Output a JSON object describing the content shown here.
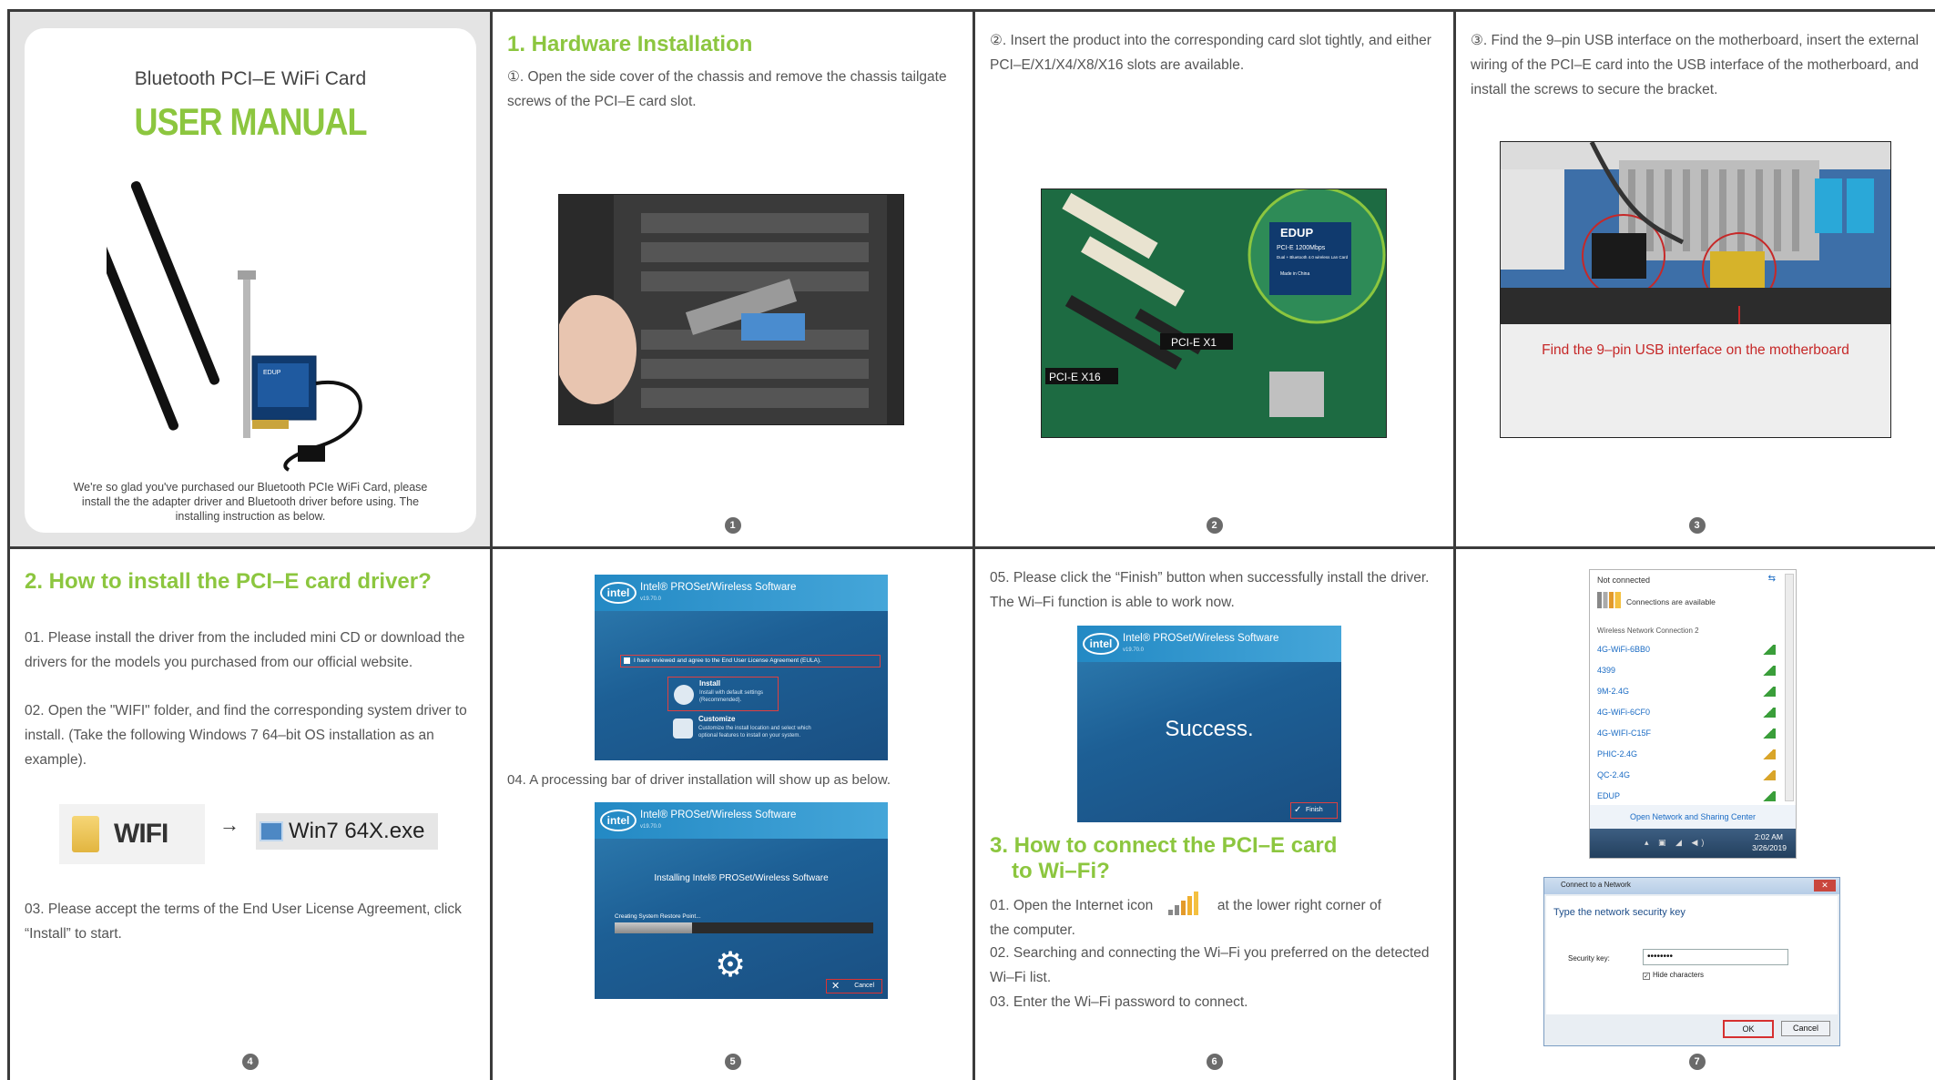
{
  "cover": {
    "subtitle": "Bluetooth PCI–E WiFi Card",
    "title": "USER MANUAL",
    "intro": "We're so glad you've purchased our Bluetooth PCIe WiFi Card, please install the the adapter driver and Bluetooth driver before using. The installing instruction as below."
  },
  "panel2": {
    "heading": "1. Hardware Installation",
    "text": "①. Open the side cover of the chassis and remove the chassis tailgate screws of the PCI–E card slot.",
    "num": "1"
  },
  "panel3": {
    "text": "②. Insert the product into the corresponding card slot tightly, and either PCI–E/X1/X4/X8/X16 slots are available.",
    "label_x1": "PCI-E X1",
    "label_x16": "PCI-E X16",
    "badge_brand": "EDUP",
    "badge_line1": "PCI-E 1200Mbps",
    "badge_line2": "Dual + Bluetooth 4.0 wireless Lan Card",
    "badge_line3": "Made in China",
    "num": "2"
  },
  "panel4": {
    "text": "③. Find the 9–pin USB interface on the motherboard, insert the external wiring of the PCI–E card into the USB interface of the motherboard, and install the screws to secure the bracket.",
    "caption": "Find the 9–pin USB interface on the motherboard",
    "num": "3"
  },
  "panel5": {
    "heading": "2. How to install the PCI–E card driver?",
    "step1": "01. Please install the driver from the included mini CD or download the drivers for the models you purchased from our official website.",
    "step2": "02. Open the \"WIFI\" folder, and find the corresponding system driver to install. (Take the following Windows 7 64–bit OS installation as an example).",
    "folder_label": "WIFI",
    "arrow": "→",
    "exe_label": "Win7 64X.exe",
    "step3": "03. Please accept the terms of the End User License Agreement, click “Install” to start.",
    "num": "4"
  },
  "panel6": {
    "intel_logo": "intel",
    "app_name": "Intel® PROSet/Wireless Software",
    "version": "v19.70.0",
    "eula": "I have reviewed and agree to the End User License Agreement (EULA).",
    "install_title": "Install",
    "install_desc": "Install with default settings (Recommended).",
    "customize_title": "Customize",
    "customize_desc": "Customize the install location and select which optional features to install on your system.",
    "step4": "04. A processing bar of driver installation will show up as below.",
    "installing": "Installing Intel® PROSet/Wireless Software",
    "restore": "Creating System Restore Point...",
    "cancel": "Cancel",
    "progress": 0.3,
    "num": "5"
  },
  "panel7": {
    "step5": "05. Please click the “Finish” button when successfully install the driver. The Wi–Fi function is able to work now.",
    "success": "Success.",
    "finish": "Finish",
    "heading_line1": "3. How to connect the PCI–E card",
    "heading_line2": "to Wi–Fi?",
    "s1a": "01. Open the Internet icon",
    "s1b": "at the lower right corner of",
    "s1c": "the computer.",
    "s2": "02.  Searching and connecting the Wi–Fi you preferred on the detected Wi–Fi list.",
    "s3": "03. Enter the Wi–Fi password to connect.",
    "num": "6"
  },
  "panel8": {
    "not_connected": "Not connected",
    "available": "Connections are available",
    "section": "Wireless Network Connection 2",
    "networks": [
      "4G-WiFi-6BB0",
      "4399",
      "9M-2.4G",
      "4G-WiFi-6CF0",
      "4G-WIFI-C15F",
      "PHIC-2.4G",
      "QC-2.4G",
      "EDUP"
    ],
    "open_center": "Open Network and Sharing Center",
    "time": "2:02 AM",
    "date": "3/26/2019",
    "dialog_title": "Connect to a Network",
    "dialog_heading": "Type the network security key",
    "key_label": "Security key:",
    "key_value": "••••••••",
    "hide": "Hide characters",
    "ok": "OK",
    "cancel": "Cancel",
    "num": "7"
  }
}
